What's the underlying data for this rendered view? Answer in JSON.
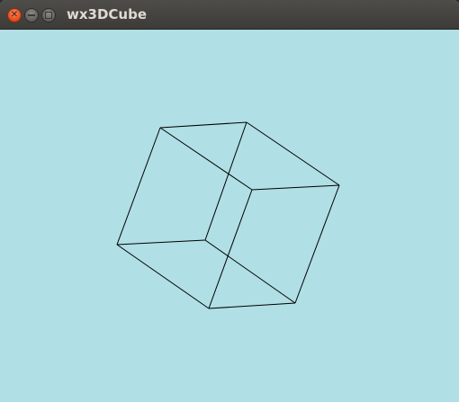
{
  "window": {
    "title": "wx3DCube",
    "background_color": "#b0dfe5",
    "line_color": "#000000"
  },
  "titlebar": {
    "close_icon": "close-icon",
    "minimize_icon": "minimize-icon",
    "maximize_icon": "maximize-icon",
    "close_glyph": "✕"
  },
  "cube": {
    "edge_count": 12,
    "vertex_count": 8
  }
}
